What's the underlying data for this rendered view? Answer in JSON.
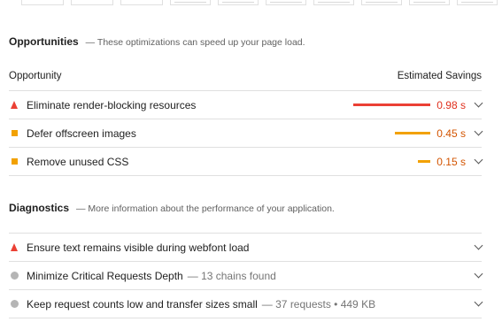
{
  "opportunities": {
    "title": "Opportunities",
    "description": "— These optimizations can speed up your page load.",
    "col_opportunity": "Opportunity",
    "col_savings": "Estimated Savings",
    "items": [
      {
        "title": "Eliminate render-blocking resources",
        "value": "0.98 s",
        "severity": "fail",
        "savings_fraction": 1.0
      },
      {
        "title": "Defer offscreen images",
        "value": "0.45 s",
        "severity": "average",
        "savings_fraction": 0.46
      },
      {
        "title": "Remove unused CSS",
        "value": "0.15 s",
        "severity": "average",
        "savings_fraction": 0.16
      }
    ]
  },
  "diagnostics": {
    "title": "Diagnostics",
    "description": "— More information about the performance of your application.",
    "items": [
      {
        "title": "Ensure text remains visible during webfont load",
        "extra": "",
        "severity": "fail"
      },
      {
        "title": "Minimize Critical Requests Depth",
        "extra": "— 13 chains found",
        "severity": "info"
      },
      {
        "title": "Keep request counts low and transfer sizes small",
        "extra": "— 37 requests • 449 KB",
        "severity": "info"
      }
    ]
  },
  "colors": {
    "fail": "#eb4034",
    "average": "#f2a100",
    "fail_text": "#e0301e",
    "average_text": "#d35400",
    "info": "#b5b5b5"
  },
  "icons": {
    "fail": "red-triangle-icon",
    "average": "orange-square-icon",
    "info": "gray-circle-icon",
    "expand": "chevron-down-icon"
  }
}
